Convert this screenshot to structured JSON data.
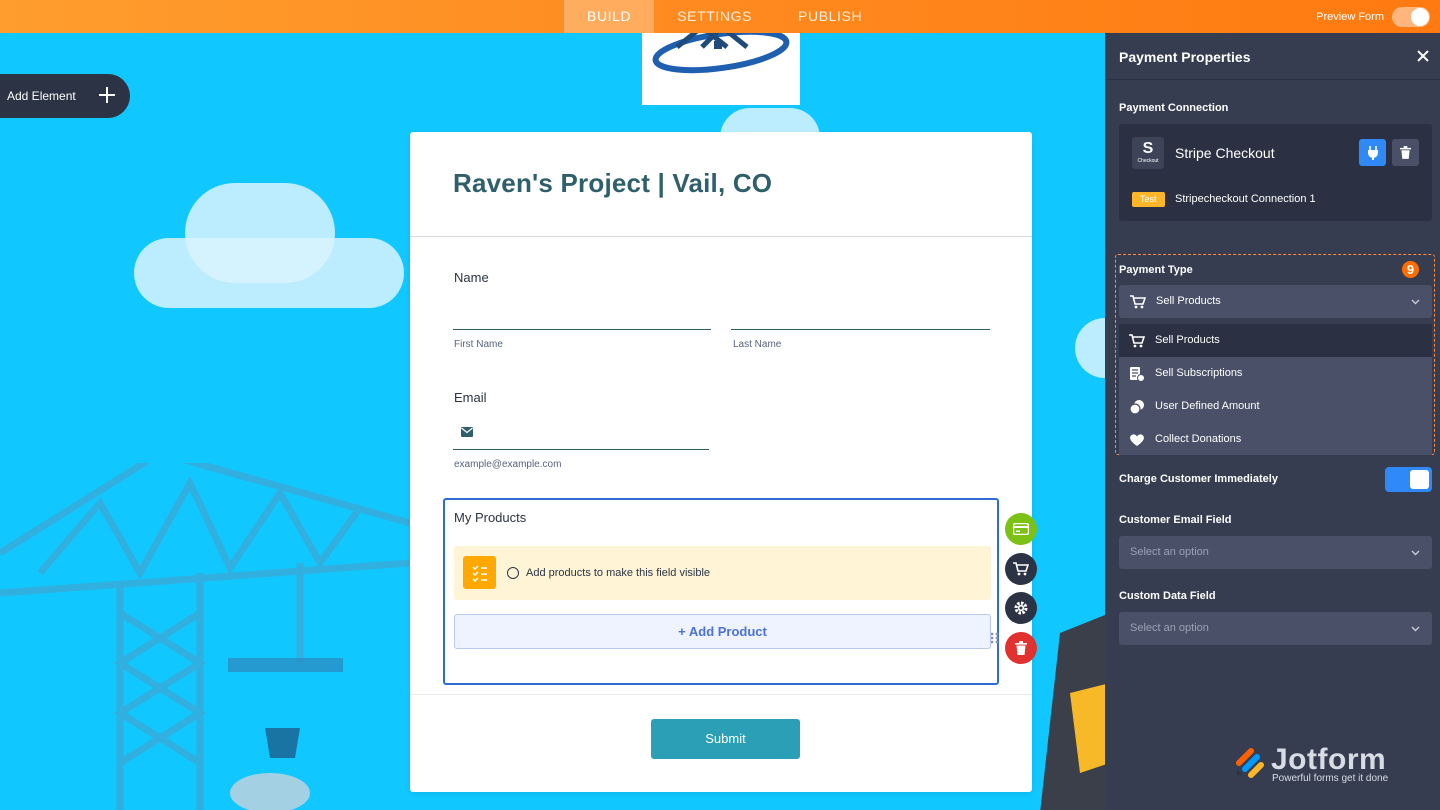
{
  "topbar": {
    "tabs": [
      {
        "label": "BUILD",
        "active": true
      },
      {
        "label": "SETTINGS",
        "active": false
      },
      {
        "label": "PUBLISH",
        "active": false
      }
    ],
    "preview_label": "Preview Form",
    "accent": "#ff8a1f"
  },
  "canvas": {
    "add_element_label": "Add Element",
    "background": "#10c8ff"
  },
  "form": {
    "title": "Raven's Project | Vail, CO",
    "name_label": "Name",
    "first_name_sublabel": "First Name",
    "last_name_sublabel": "Last Name",
    "email_label": "Email",
    "email_sublabel": "example@example.com",
    "products_label": "My Products",
    "products_notice": "Add products to make this field visible",
    "add_product_label": "+ Add Product",
    "submit_label": "Submit"
  },
  "panel": {
    "title": "Payment Properties",
    "connection_label": "Payment Connection",
    "gateway_logo_letter": "S",
    "gateway_logo_sub": "Checkout",
    "gateway_name": "Stripe Checkout",
    "test_badge": "Test",
    "connection_name": "Stripecheckout Connection 1",
    "payment_type_label": "Payment Type",
    "step_number": "9",
    "payment_type_value": "Sell Products",
    "payment_type_options": [
      {
        "label": "Sell Products",
        "icon": "cart-icon",
        "selected": true
      },
      {
        "label": "Sell Subscriptions",
        "icon": "subscription-icon",
        "selected": false
      },
      {
        "label": "User Defined Amount",
        "icon": "coins-icon",
        "selected": false
      },
      {
        "label": "Collect Donations",
        "icon": "heart-icon",
        "selected": false
      }
    ],
    "charge_label": "Charge Customer Immediately",
    "charge_enabled": true,
    "email_field_label": "Customer Email Field",
    "email_field_placeholder": "Select an option",
    "custom_field_label": "Custom Data Field",
    "custom_field_placeholder": "Select an option",
    "brand": "Jotform",
    "brand_tagline": "Powerful forms get it done"
  }
}
